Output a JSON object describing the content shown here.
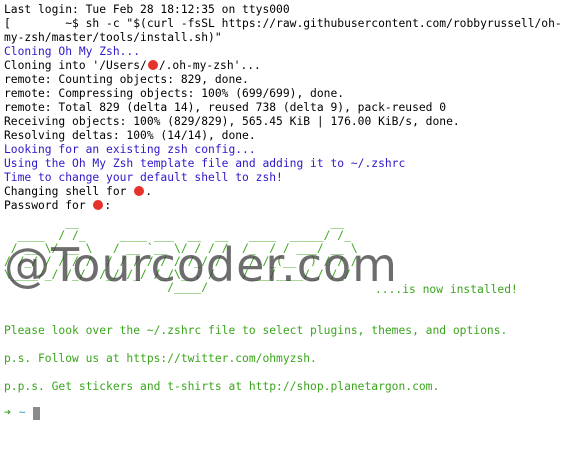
{
  "terminal": {
    "lines": [
      {
        "text": "Last login: Tue Feb 28 18:12:35 on ttys000",
        "color": "black"
      },
      {
        "text": "[        ~$ sh -c \"$(curl -fsSL https://raw.githubusercontent.com/robbyrussell/oh-",
        "color": "black"
      },
      {
        "text": "my-zsh/master/tools/install.sh)\"",
        "color": "black"
      },
      {
        "text": "Cloning Oh My Zsh...",
        "color": "blue"
      },
      {
        "text": "Cloning into '/Users/",
        "color": "black",
        "after": "/.oh-my-zsh'...",
        "redacted": true
      },
      {
        "text": "remote: Counting objects: 829, done.",
        "color": "black"
      },
      {
        "text": "remote: Compressing objects: 100% (699/699), done.",
        "color": "black"
      },
      {
        "text": "remote: Total 829 (delta 14), reused 738 (delta 9), pack-reused 0",
        "color": "black"
      },
      {
        "text": "Receiving objects: 100% (829/829), 565.45 KiB | 176.00 KiB/s, done.",
        "color": "black"
      },
      {
        "text": "Resolving deltas: 100% (14/14), done.",
        "color": "black"
      },
      {
        "text": "Looking for an existing zsh config...",
        "color": "blue"
      },
      {
        "text": "Using the Oh My Zsh template file and adding it to ~/.zshrc",
        "color": "blue"
      },
      {
        "text": "Time to change your default shell to zsh!",
        "color": "blue"
      },
      {
        "text": "Changing shell for ",
        "color": "black",
        "after": ".",
        "redacted": true
      },
      {
        "text": "Password for ",
        "color": "black",
        "after": ":",
        "redacted": true
      }
    ],
    "installed_text": "....is now installed!",
    "tail_lines": [
      "Please look over the ~/.zshrc file to select plugins, themes, and options.",
      "",
      "p.s. Follow us at https://twitter.com/ohmyzsh.",
      "",
      "p.p.s. Get stickers and t-shirts at http://shop.planetargon.com."
    ],
    "prompt_arrow": "➜",
    "prompt_dir": "~"
  },
  "watermark": "@Tourcoder.com",
  "colors": {
    "blue": "#2d18c8",
    "green": "#3aa61c",
    "cyan": "#2ea3c8",
    "redaction": "#e5322a"
  }
}
